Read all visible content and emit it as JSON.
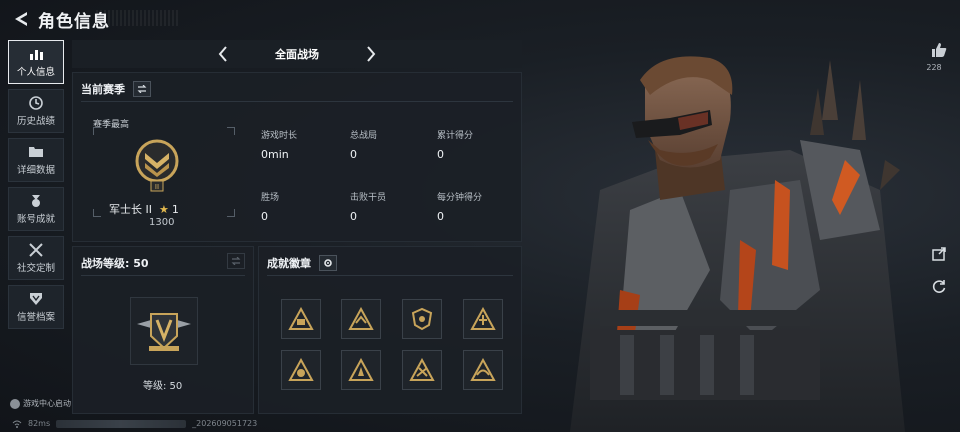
{
  "header": {
    "title": "角色信息"
  },
  "sidebar": {
    "items": [
      {
        "label": "个人信息",
        "icon": "bar-chart-icon",
        "active": true
      },
      {
        "label": "历史战绩",
        "icon": "clock-icon"
      },
      {
        "label": "详细数据",
        "icon": "folder-icon"
      },
      {
        "label": "账号成就",
        "icon": "medal-icon"
      },
      {
        "label": "社交定制",
        "icon": "tools-icon"
      },
      {
        "label": "信誉档案",
        "icon": "shield-icon"
      }
    ],
    "game_center": "游戏中心启动"
  },
  "mode": {
    "label": "全面战场"
  },
  "season": {
    "title": "当前赛季",
    "best_label": "赛季最高",
    "rank_name": "军士长 II",
    "stars": "1",
    "score": "1300",
    "stats": [
      {
        "label": "游戏时长",
        "value": "0min"
      },
      {
        "label": "总战局",
        "value": "0"
      },
      {
        "label": "累计得分",
        "value": "0"
      },
      {
        "label": "胜场",
        "value": "0"
      },
      {
        "label": "击败干员",
        "value": "0"
      },
      {
        "label": "每分钟得分",
        "value": "0"
      }
    ]
  },
  "battlepass": {
    "title": "战场等级: 50",
    "level_text": "等级: 50"
  },
  "badges": {
    "title": "成就徽章",
    "count": 8
  },
  "social": {
    "likes": "228"
  },
  "footer": {
    "ping": "82ms",
    "uid_suffix": "_202609051723"
  },
  "colors": {
    "accent_gold": "#c8a45a",
    "panel_bg": "#1b2026",
    "active_border": "#e7eaee"
  }
}
